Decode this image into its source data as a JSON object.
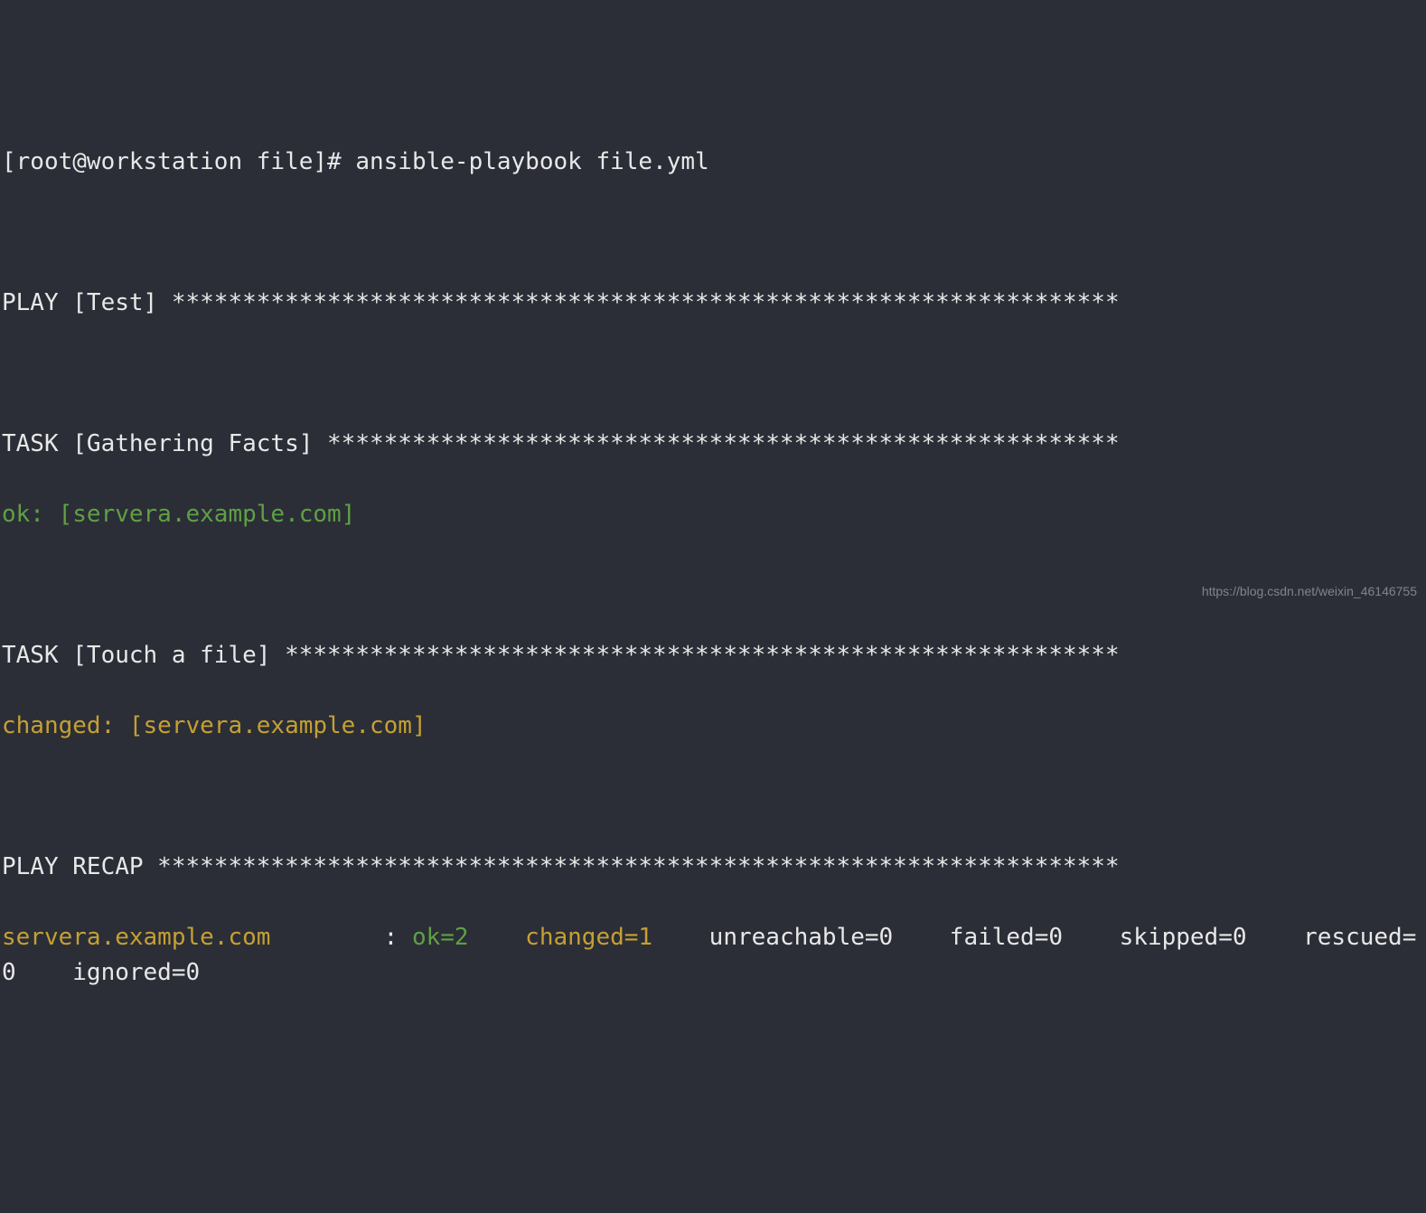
{
  "prompt": "[root@workstation file]# ",
  "command": "ansible-playbook file.yml",
  "play_header": "PLAY [Test] *******************************************************************",
  "task1_header": "TASK [Gathering Facts] ********************************************************",
  "task1_result": "ok: [servera.example.com]",
  "task2_header": "TASK [Touch a file] ***********************************************************",
  "task2_result": "changed: [servera.example.com]",
  "recap_header": "PLAY RECAP ********************************************************************",
  "recap": {
    "host": "servera.example.com        ",
    "sep": ": ",
    "ok": "ok=2   ",
    "changed": " changed=1   ",
    "rest1": " unreachable=0    failed=0    skipped=0    rescued=0    ignored=0"
  },
  "watermark": "https://blog.csdn.net/weixin_46146755"
}
